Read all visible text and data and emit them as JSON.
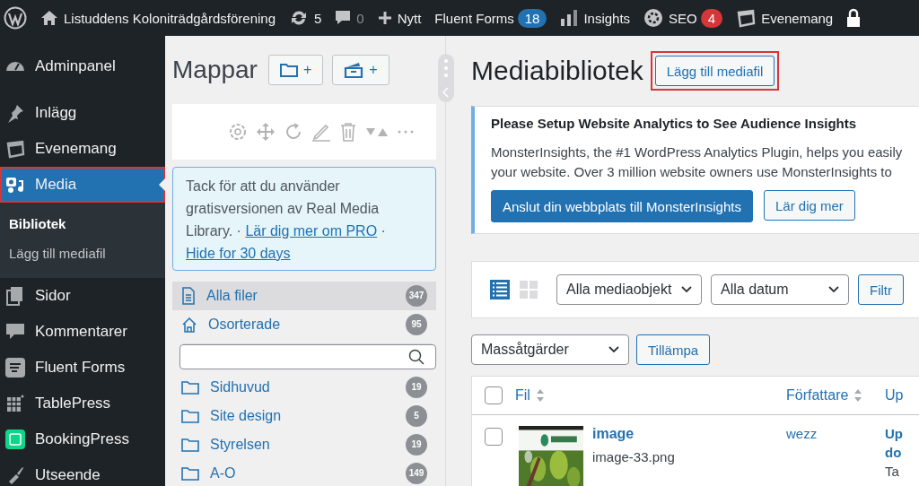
{
  "topbar": {
    "items": [
      {
        "kind": "logo"
      },
      {
        "kind": "site",
        "label": "Listuddens Koloniträdgårdsförening"
      },
      {
        "kind": "updates",
        "label": "5"
      },
      {
        "kind": "comments",
        "label": "0"
      },
      {
        "kind": "new",
        "label": "Nytt"
      },
      {
        "kind": "forms",
        "label": "Fluent Forms",
        "badge": "18",
        "color": "#2271b1"
      },
      {
        "kind": "insights",
        "label": "Insights"
      },
      {
        "kind": "seo",
        "label": "SEO",
        "badge": "4",
        "color": "#d63638"
      },
      {
        "kind": "events",
        "label": "Evenemang"
      },
      {
        "kind": "lock"
      }
    ]
  },
  "sidebar": {
    "items": [
      {
        "kind": "dashboard",
        "label": "Adminpanel",
        "selected": false
      },
      {
        "kind": "pin",
        "label": "Inlägg",
        "selected": false
      },
      {
        "kind": "calendar",
        "label": "Evenemang",
        "selected": false
      },
      {
        "kind": "media",
        "label": "Media",
        "selected": true,
        "children": [
          {
            "label": "Bibliotek",
            "selected": true
          },
          {
            "label": "Lägg till mediafil",
            "selected": false
          }
        ]
      },
      {
        "kind": "pages",
        "label": "Sidor",
        "selected": false
      },
      {
        "kind": "comment",
        "label": "Kommentarer",
        "selected": false
      },
      {
        "kind": "forms",
        "label": "Fluent Forms",
        "selected": false
      },
      {
        "kind": "table",
        "label": "TablePress",
        "selected": false
      },
      {
        "kind": "booking",
        "label": "BookingPress",
        "selected": false
      },
      {
        "kind": "brush",
        "label": "Utseende",
        "selected": false
      }
    ]
  },
  "folders": {
    "title": "Mappar",
    "add_buttons": [
      {
        "kind": "folder",
        "label": "+"
      },
      {
        "kind": "gallery",
        "label": "+"
      }
    ],
    "notice": {
      "text": "Tack för att du använder gratisversionen av Real Media Library. · ",
      "link": "Lär dig mer om PRO",
      "separator": " · ",
      "link2": "Hide for 30 days"
    },
    "special": [
      {
        "kind": "all",
        "label": "Alla filer",
        "count": "347",
        "selected": true
      },
      {
        "kind": "unsorted",
        "label": "Osorterade",
        "count": "95",
        "selected": false
      }
    ],
    "items": [
      {
        "label": "Sidhuvud",
        "count": "19"
      },
      {
        "label": "Site design",
        "count": "5"
      },
      {
        "label": "Styrelsen",
        "count": "19"
      },
      {
        "label": "A-O",
        "count": "149"
      }
    ]
  },
  "main": {
    "title": "Mediabibliotek",
    "add_button": "Lägg till mediafil",
    "notice": {
      "title": "Please Setup Website Analytics to See Audience Insights",
      "lines": [
        "MonsterInsights, the #1 WordPress Analytics Plugin, helps you easily",
        "your website. Over 3 million website owners use MonsterInsights to"
      ],
      "buttons": [
        {
          "kind": "primary",
          "label": "Anslut din webbplats till MonsterInsights"
        },
        {
          "kind": "secondary",
          "label": "Lär dig mer"
        }
      ]
    },
    "views": [
      {
        "kind": "list",
        "selected": true
      },
      {
        "kind": "grid",
        "selected": false
      }
    ],
    "filters": [
      "Alla mediaobjekt",
      "Alla datum"
    ],
    "filter_button": "Filtr",
    "bulk_select": "Massåtgärder",
    "apply_button": "Tillämpa",
    "table": {
      "select_all_checked": false,
      "columns": [
        {
          "label": "Fil",
          "sortable": true
        },
        {
          "label": "Författare",
          "sortable": true
        },
        {
          "label": "Up",
          "sortable": false
        }
      ],
      "rows": [
        {
          "checked": false,
          "title": "image",
          "filename": "image-33.png",
          "author": "wezz",
          "column_3": [
            {
              "kind": "link",
              "text": "Up"
            },
            {
              "kind": "link",
              "text": "do"
            },
            {
              "kind": "plain",
              "text": "Ta"
            }
          ]
        }
      ]
    }
  }
}
